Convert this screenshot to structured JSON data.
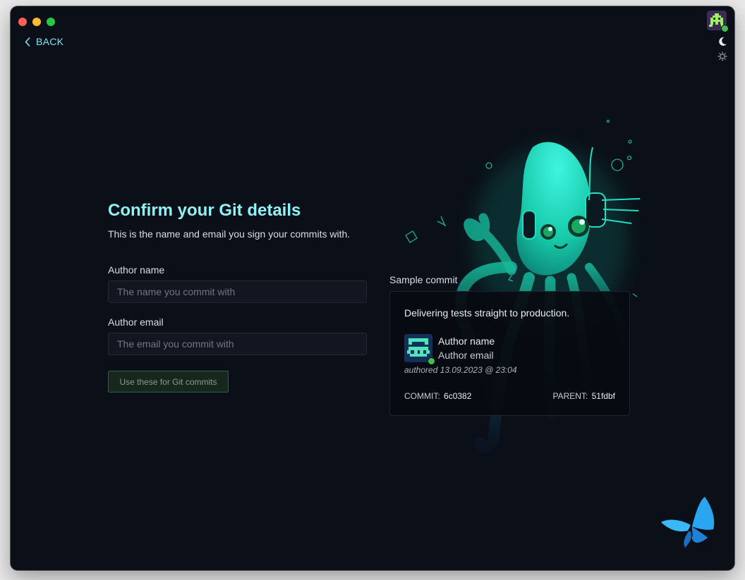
{
  "nav": {
    "back_label": "BACK"
  },
  "header": {
    "title": "Confirm your Git details"
  },
  "intro": {
    "subtitle": "This is the name and email you sign your commits with."
  },
  "form": {
    "author_name_label": "Author name",
    "author_name_placeholder": "The name you commit with",
    "author_name_value": "",
    "author_email_label": "Author email",
    "author_email_placeholder": "The email you commit with",
    "author_email_value": "",
    "submit_label": "Use these for Git commits"
  },
  "sample": {
    "label": "Sample commit",
    "message": "Delivering tests straight to production.",
    "author_name": "Author name",
    "author_email": "Author email",
    "authored_prefix": "authored",
    "authored_date": "13.09.2023 @ 23:04",
    "commit_label": "COMMIT:",
    "commit_hash": "6c0382",
    "parent_label": "PARENT:",
    "parent_hash": "51fdbf"
  },
  "icons": {
    "back": "chevron-left-icon",
    "theme": "moon-icon",
    "settings": "gear-icon",
    "avatar": "pixel-invader-avatar",
    "illustration": "gitkraken-squid-headphones",
    "decoration": "blue-butterfly"
  },
  "colors": {
    "background": "#0b0f17",
    "title": "#8ff2f5",
    "accent_green": "#3fbf4f",
    "squid_glow": "#1fe0c0",
    "avatar_purple": "#3b2a56",
    "avatar_green": "#9cf25a",
    "commit_avatar_teal": "#4ee6b8",
    "button_border": "#2f5f3b",
    "butterfly_blue": "#2aa6f0"
  }
}
